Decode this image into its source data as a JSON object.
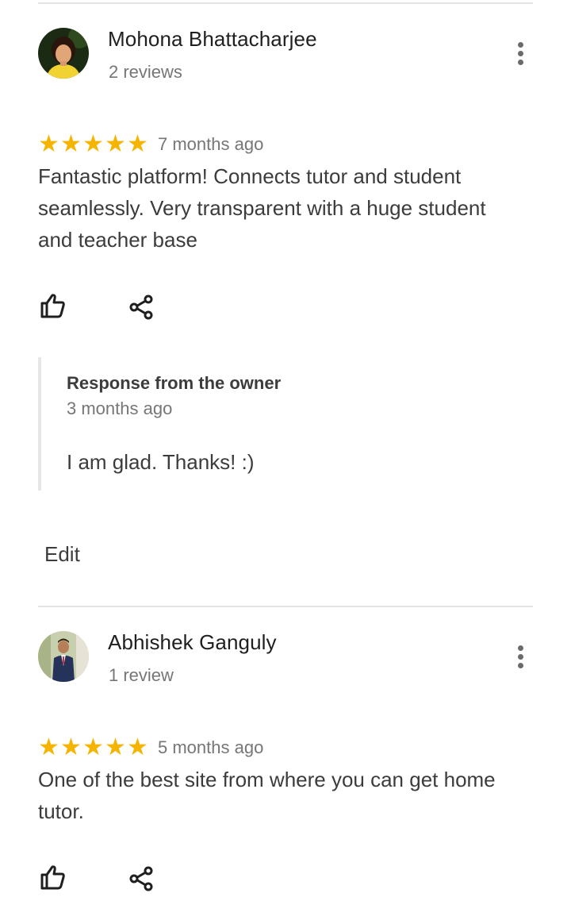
{
  "reviews": [
    {
      "author": "Mohona Bhattacharjee",
      "review_count": "2 reviews",
      "rating": 5,
      "stars": [
        "★",
        "★",
        "★",
        "★",
        "★"
      ],
      "date": "7 months ago",
      "text": "Fantastic platform! Connects tutor and student seamlessly. Very transparent with a huge student and teacher base",
      "response": {
        "title": "Response from the owner",
        "date": "3 months ago",
        "text": "I am glad. Thanks! :)"
      },
      "edit_label": "Edit"
    },
    {
      "author": "Abhishek Ganguly",
      "review_count": "1 review",
      "rating": 5,
      "stars": [
        "★",
        "★",
        "★",
        "★",
        "★"
      ],
      "date": "5 months ago",
      "text": "One of the best site from where you can get home tutor."
    }
  ],
  "icons": {
    "like": "thumb-up-icon",
    "share": "share-icon",
    "more": "more-vert-icon"
  },
  "colors": {
    "star": "#f5b400",
    "secondary_text": "#767676",
    "divider": "#e3e3e3"
  }
}
